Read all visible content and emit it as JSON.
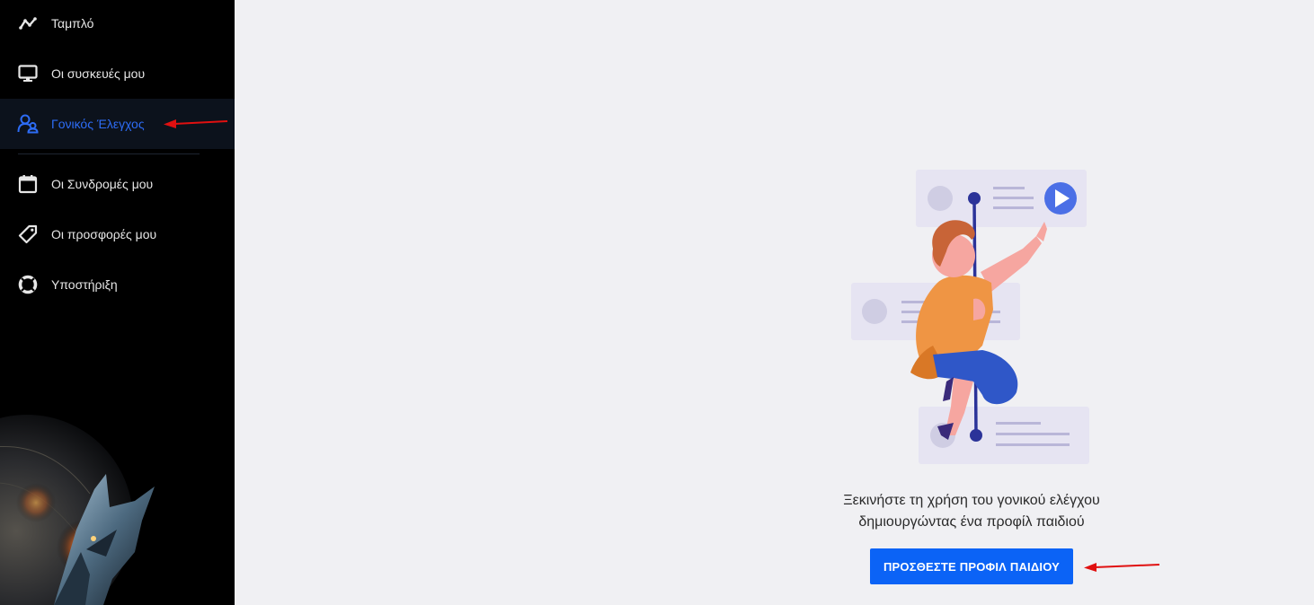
{
  "sidebar": {
    "items": [
      {
        "label": "Ταμπλό",
        "icon": "chart-line-icon"
      },
      {
        "label": "Οι συσκευές μου",
        "icon": "monitor-icon"
      },
      {
        "label": "Γονικός Έλεγχος",
        "icon": "parental-control-icon",
        "active": true
      },
      {
        "label": "Οι Συνδρομές μου",
        "icon": "calendar-icon"
      },
      {
        "label": "Οι προσφορές μου",
        "icon": "tag-icon"
      },
      {
        "label": "Υποστήριξη",
        "icon": "lifebuoy-icon"
      }
    ]
  },
  "main": {
    "message_line1": "Ξεκινήστε τη χρήση του γονικού ελέγχου",
    "message_line2": "δημιουργώντας ένα προφίλ παιδιού",
    "cta_label": "ΠΡΟΣΘΕΣΤΕ ΠΡΟΦΙΛ ΠΑΙΔΙΟΥ"
  },
  "colors": {
    "accent": "#0b63f6",
    "active_text": "#2d6cf5",
    "sidebar_bg": "#000000",
    "main_bg": "#f0f0f3",
    "annotation_arrow": "#e01010"
  }
}
